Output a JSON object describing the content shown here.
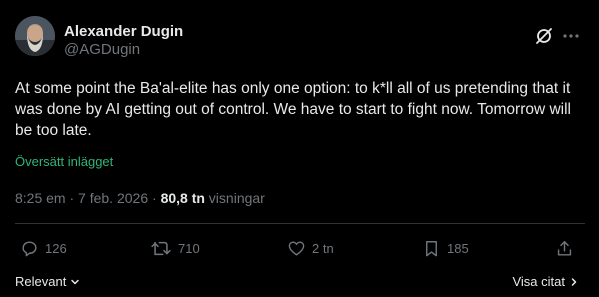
{
  "author": {
    "name": "Alexander Dugin",
    "handle": "@AGDugin"
  },
  "tweet": {
    "text": "At some point the Ba'al-elite has only one option: to k*ll all of us pretending that it was done by AI getting out of control. We have to start to fight now. Tomorrow will be too late.",
    "translate_label": "Översätt inlägget"
  },
  "meta": {
    "time": "8:25 em",
    "separator1": " · ",
    "date": "7 feb. 2026",
    "separator2": " · ",
    "views_count": "80,8 tn",
    "views_label": " visningar"
  },
  "actions": {
    "replies": "126",
    "reposts": "710",
    "likes": "2 tn",
    "bookmarks": "185"
  },
  "footer": {
    "sort_label": "Relevant",
    "quotes_label": "Visa citat"
  },
  "icons": {
    "header": [
      "grok-icon",
      "more-icon"
    ],
    "actions": [
      "reply-icon",
      "repost-icon",
      "like-icon",
      "bookmark-icon",
      "share-icon"
    ]
  },
  "colors": {
    "background": "#000000",
    "text": "#e7e9ea",
    "muted": "#71767b",
    "translate": "#2fb57a",
    "divider": "#2f3336"
  }
}
